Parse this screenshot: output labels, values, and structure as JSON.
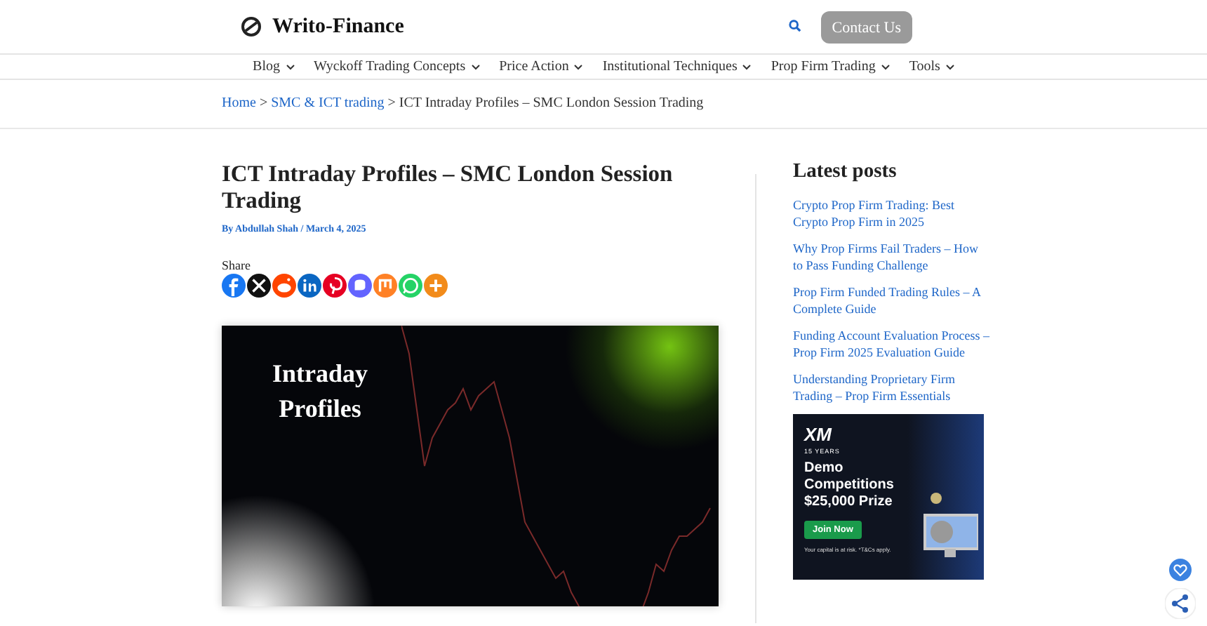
{
  "header": {
    "site_name": "Writo-Finance",
    "contact_button": "Contact Us"
  },
  "nav": [
    {
      "label": "Blog"
    },
    {
      "label": "Wyckoff Trading Concepts"
    },
    {
      "label": "Price Action"
    },
    {
      "label": "Institutional Techniques"
    },
    {
      "label": "Prop Firm Trading"
    },
    {
      "label": "Tools"
    }
  ],
  "breadcrumbs": {
    "links": [
      "Home",
      "SMC & ICT trading"
    ],
    "separator": ">",
    "current": "ICT Intraday Profiles – SMC London Session Trading"
  },
  "article": {
    "title": "ICT Intraday Profiles – SMC London Session Trading",
    "author": "By Abdullah Shah",
    "date": "March 4, 2025",
    "meta_separator": "/",
    "share_label": "Share",
    "share_buttons": [
      {
        "kind": "facebook"
      },
      {
        "kind": "x"
      },
      {
        "kind": "reddit"
      },
      {
        "kind": "linkedin"
      },
      {
        "kind": "pinterest"
      },
      {
        "kind": "mastodon"
      },
      {
        "kind": "mix"
      },
      {
        "kind": "whatsapp"
      },
      {
        "kind": "more"
      }
    ],
    "image_title": "Intraday Profiles"
  },
  "sidebar": {
    "heading": "Latest posts",
    "posts": [
      "Crypto Prop Firm Trading: Best Crypto Prop Firm in 2025",
      "Why Prop Firms Fail Traders – How to Pass Funding Challenge",
      "Prop Firm Funded Trading Rules – A Complete Guide",
      "Funding Account Evaluation Process – Prop Firm 2025 Evaluation Guide",
      "Understanding Proprietary Firm Trading – Prop Firm Essentials"
    ],
    "ad": {
      "brand": "XM",
      "badge": "15 YEARS",
      "headline": "Demo Competitions $25,000 Prize",
      "button": "Join Now",
      "disclaimer": "Your capital is at risk. *T&Cs apply."
    }
  }
}
